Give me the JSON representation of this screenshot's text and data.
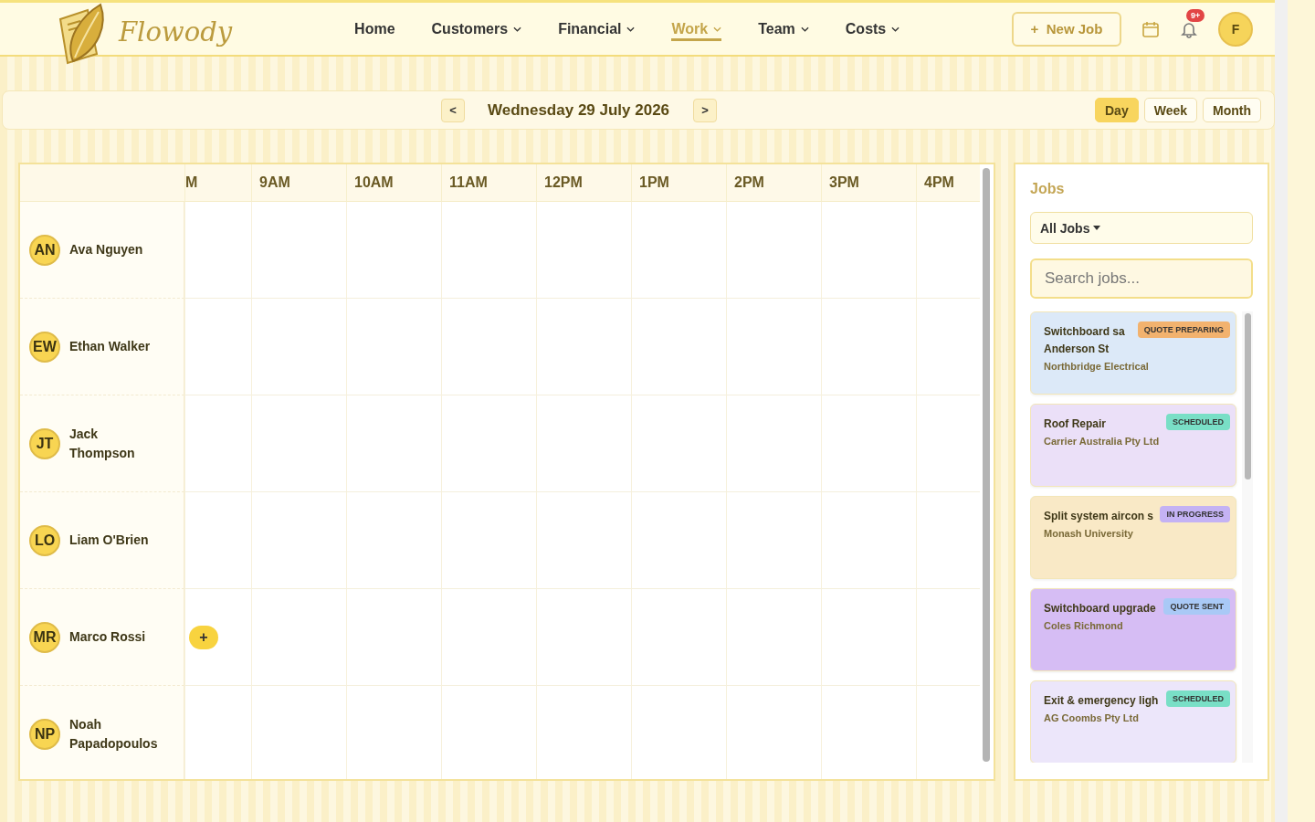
{
  "header": {
    "brand": "Flowody",
    "nav": [
      {
        "label": "Home",
        "dropdown": false,
        "selected": false
      },
      {
        "label": "Customers",
        "dropdown": true,
        "selected": false
      },
      {
        "label": "Financial",
        "dropdown": true,
        "selected": false
      },
      {
        "label": "Work",
        "dropdown": true,
        "selected": true
      },
      {
        "label": "Team",
        "dropdown": true,
        "selected": false
      },
      {
        "label": "Costs",
        "dropdown": true,
        "selected": false
      }
    ],
    "new_job": "+  New Job",
    "notification_count": "9+",
    "avatar": "F"
  },
  "toolbar": {
    "prev": "<",
    "date": "Wednesday 29 July 2026",
    "next": ">",
    "views": [
      {
        "label": "Day",
        "selected": true
      },
      {
        "label": "Week",
        "selected": false
      },
      {
        "label": "Month",
        "selected": false
      }
    ]
  },
  "schedule": {
    "first_column": "M",
    "hours": [
      "9AM",
      "10AM",
      "11AM",
      "12PM",
      "1PM",
      "2PM",
      "3PM",
      "4PM"
    ],
    "staff": [
      {
        "initials": "AN",
        "name": "Ava Nguyen",
        "add_button": false
      },
      {
        "initials": "EW",
        "name": "Ethan Walker",
        "add_button": false
      },
      {
        "initials": "JT",
        "name": "Jack Thompson",
        "add_button": false
      },
      {
        "initials": "LO",
        "name": "Liam O'Brien",
        "add_button": false
      },
      {
        "initials": "MR",
        "name": "Marco Rossi",
        "add_button": true
      },
      {
        "initials": "NP",
        "name": "Noah Papadopoulos",
        "add_button": false
      }
    ],
    "add_label": "+"
  },
  "jobs_panel": {
    "title": "Jobs",
    "filter": "All Jobs",
    "search_placeholder": "Search jobs...",
    "jobs": [
      {
        "title": [
          "Switchboard sa",
          "Anderson St"
        ],
        "customer": "Northbridge Electrical",
        "status": {
          "label": "QUOTE PREPARING",
          "color": "#f2b26e"
        },
        "color": "#dce9f8"
      },
      {
        "title": [
          "Roof Repair"
        ],
        "customer": "Carrier Australia Pty Ltd",
        "status": {
          "label": "SCHEDULED",
          "color": "#79dfc6"
        },
        "color": "#ebe0f8"
      },
      {
        "title": [
          "Split system aircon s"
        ],
        "customer": "Monash University",
        "status": {
          "label": "IN PROGRESS",
          "color": "#c4b2f4"
        },
        "color": "#f9e9c6"
      },
      {
        "title": [
          "Switchboard upgrade"
        ],
        "customer": "Coles Richmond",
        "status": {
          "label": "QUOTE SENT",
          "color": "#a9c9f6"
        },
        "color": "#d6bdf4"
      },
      {
        "title": [
          "Exit & emergency ligh"
        ],
        "customer": "AG Coombs Pty Ltd",
        "status": {
          "label": "SCHEDULED",
          "color": "#79dfc6"
        },
        "color": "#ece6fa"
      }
    ]
  }
}
